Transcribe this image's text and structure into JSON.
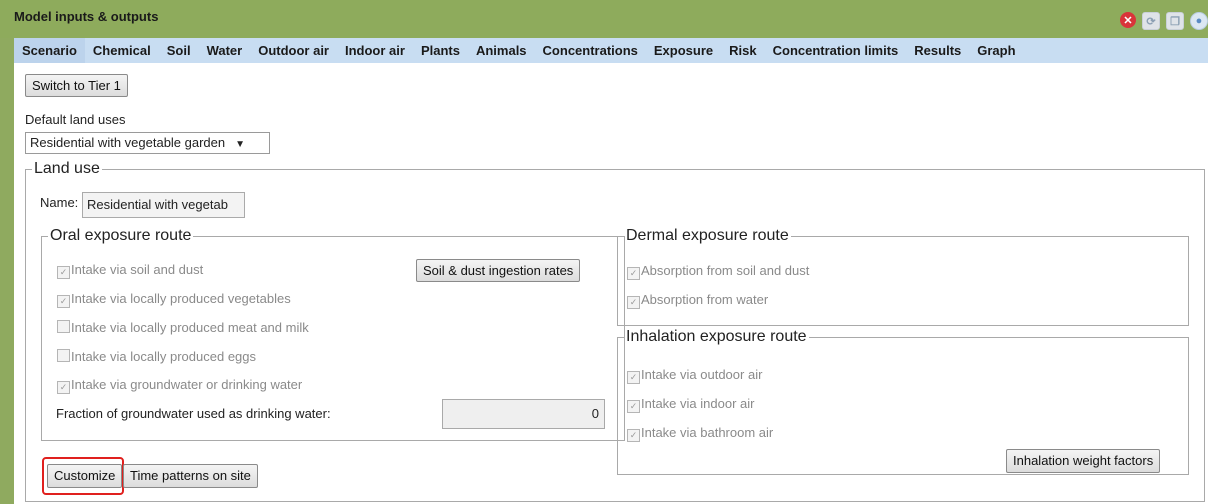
{
  "window": {
    "title": "Model inputs & outputs",
    "icons": [
      "close-icon",
      "refresh-icon",
      "copy-icon",
      "info-icon"
    ]
  },
  "tabs": [
    {
      "label": "Scenario",
      "active": true
    },
    {
      "label": "Chemical"
    },
    {
      "label": "Soil"
    },
    {
      "label": "Water"
    },
    {
      "label": "Outdoor air"
    },
    {
      "label": "Indoor air"
    },
    {
      "label": "Plants"
    },
    {
      "label": "Animals"
    },
    {
      "label": "Concentrations"
    },
    {
      "label": "Exposure"
    },
    {
      "label": "Risk"
    },
    {
      "label": "Concentration limits"
    },
    {
      "label": "Results"
    },
    {
      "label": "Graph"
    }
  ],
  "scenario": {
    "switch_tier_label": "Switch to Tier 1",
    "default_land_uses_label": "Default land uses",
    "default_land_uses_value": "Residential with vegetable garden",
    "land_use": {
      "legend": "Land use",
      "name_label": "Name:",
      "name_value": "Residential with vegetab",
      "oral": {
        "legend": "Oral exposure route",
        "items": [
          {
            "label": "Intake via soil and dust",
            "checked": true
          },
          {
            "label": "Intake via locally produced vegetables",
            "checked": true
          },
          {
            "label": "Intake via locally produced meat and milk",
            "checked": false
          },
          {
            "label": "Intake via locally produced eggs",
            "checked": false
          },
          {
            "label": "Intake via groundwater or drinking water",
            "checked": true
          }
        ],
        "ingestion_button": "Soil & dust ingestion rates",
        "fraction_label": "Fraction of groundwater used as drinking water:",
        "fraction_value": "0"
      },
      "dermal": {
        "legend": "Dermal exposure route",
        "items": [
          {
            "label": "Absorption from soil and dust",
            "checked": true
          },
          {
            "label": "Absorption from water",
            "checked": true
          }
        ]
      },
      "inhalation": {
        "legend": "Inhalation exposure route",
        "items": [
          {
            "label": "Intake via outdoor air",
            "checked": true
          },
          {
            "label": "Intake via indoor air",
            "checked": true
          },
          {
            "label": "Intake via bathroom air",
            "checked": true
          }
        ],
        "weight_button": "Inhalation weight factors"
      },
      "customize_button": "Customize",
      "time_patterns_button": "Time patterns on site"
    }
  },
  "colors": {
    "title_bar": "#8eab5c",
    "tab_bar": "#c8ddf2",
    "highlight": "#e0201e"
  }
}
